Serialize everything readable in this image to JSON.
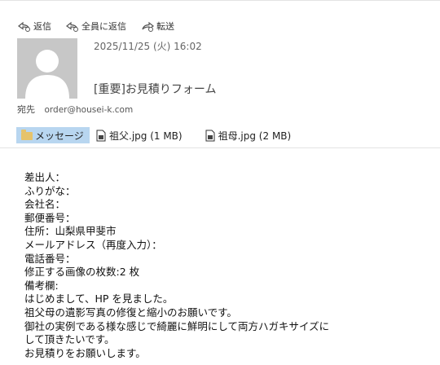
{
  "toolbar": {
    "reply_label": "返信",
    "reply_all_label": "全員に返信",
    "forward_label": "転送"
  },
  "message": {
    "date": "2025/11/25 (火) 16:02",
    "subject": "[重要]お見積りフォーム",
    "to_label": "宛先",
    "to_address": "order@housei-k.com"
  },
  "attachments": {
    "message_tab": "メッセージ",
    "files": [
      {
        "name": "祖父.jpg (1 MB)"
      },
      {
        "name": "祖母.jpg (2 MB)"
      }
    ]
  },
  "body": {
    "lines": [
      "差出人：",
      "ふりがな：",
      "会社名：",
      "郵便番号：",
      "住所：山梨県甲斐市",
      "メールアドレス（再度入力）：",
      "電話番号：",
      "修正する画像の枚数:2 枚",
      "備考欄:",
      "はじめまして、HP を見ました。",
      "祖父母の遺影写真の修復と縮小のお願いです。",
      "御社の実例である様な感じで綺麗に鮮明にして両方ハガキサイズに",
      "して頂きたいです。",
      "お見積りをお願いします。"
    ]
  }
}
